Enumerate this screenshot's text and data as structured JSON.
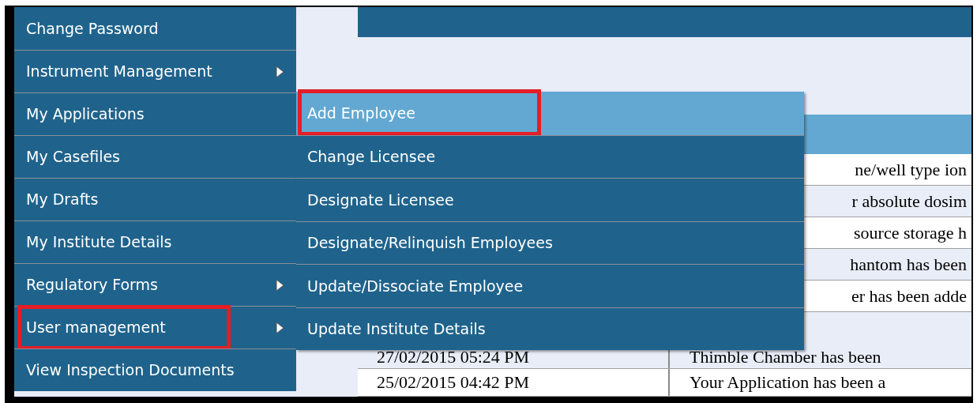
{
  "menu": {
    "items": [
      {
        "label": "Change Password",
        "has_submenu": false,
        "annotated": false
      },
      {
        "label": "Instrument Management",
        "has_submenu": true,
        "annotated": false
      },
      {
        "label": "My Applications",
        "has_submenu": false,
        "annotated": false
      },
      {
        "label": "My Casefiles",
        "has_submenu": false,
        "annotated": false
      },
      {
        "label": "My Drafts",
        "has_submenu": false,
        "annotated": false
      },
      {
        "label": "My Institute Details",
        "has_submenu": false,
        "annotated": false
      },
      {
        "label": "Regulatory Forms",
        "has_submenu": true,
        "annotated": false
      },
      {
        "label": "User management",
        "has_submenu": true,
        "annotated": true
      },
      {
        "label": "View Inspection Documents",
        "has_submenu": false,
        "annotated": false
      }
    ]
  },
  "submenu": {
    "items": [
      {
        "label": "Add Employee",
        "selected": true,
        "annotated": true
      },
      {
        "label": "Change Licensee",
        "selected": false,
        "annotated": false
      },
      {
        "label": "Designate Licensee",
        "selected": false,
        "annotated": false
      },
      {
        "label": "Designate/Relinquish Employees",
        "selected": false,
        "annotated": false
      },
      {
        "label": "Update/Dissociate Employee",
        "selected": false,
        "annotated": false
      },
      {
        "label": "Update Institute Details",
        "selected": false,
        "annotated": false
      }
    ]
  },
  "table": {
    "rows": [
      {
        "date": "",
        "message": "ne/well type ion"
      },
      {
        "date": "",
        "message": "r absolute dosim"
      },
      {
        "date": "",
        "message": "source storage h"
      },
      {
        "date": "",
        "message": "hantom has been"
      },
      {
        "date": "",
        "message": "er has been adde"
      },
      {
        "date": "27/02/2015 05:24 PM",
        "message": "Thimble Chamber has been"
      },
      {
        "date": "25/02/2015 04:42 PM",
        "message": "Your Application has been a"
      }
    ]
  }
}
